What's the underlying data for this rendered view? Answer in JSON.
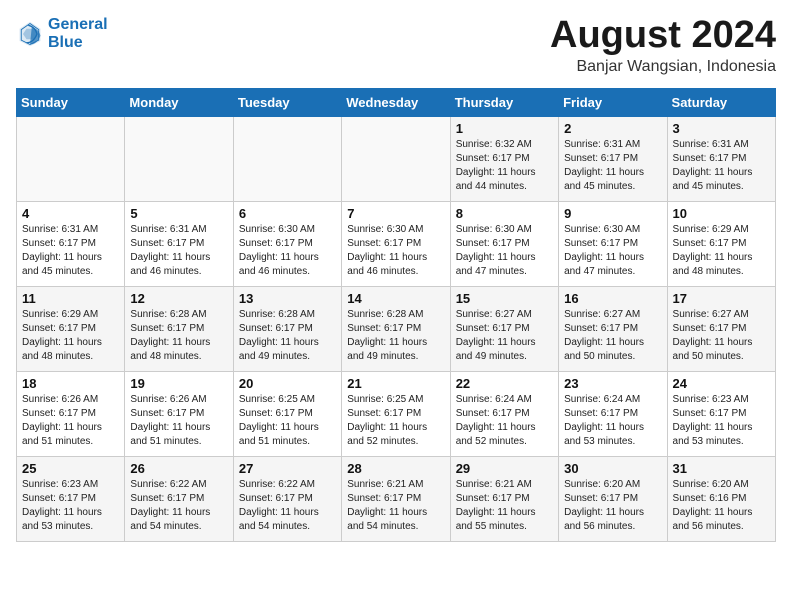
{
  "header": {
    "logo_line1": "General",
    "logo_line2": "Blue",
    "month_title": "August 2024",
    "subtitle": "Banjar Wangsian, Indonesia"
  },
  "days_of_week": [
    "Sunday",
    "Monday",
    "Tuesday",
    "Wednesday",
    "Thursday",
    "Friday",
    "Saturday"
  ],
  "weeks": [
    [
      {
        "day": "",
        "info": ""
      },
      {
        "day": "",
        "info": ""
      },
      {
        "day": "",
        "info": ""
      },
      {
        "day": "",
        "info": ""
      },
      {
        "day": "1",
        "info": "Sunrise: 6:32 AM\nSunset: 6:17 PM\nDaylight: 11 hours\nand 44 minutes."
      },
      {
        "day": "2",
        "info": "Sunrise: 6:31 AM\nSunset: 6:17 PM\nDaylight: 11 hours\nand 45 minutes."
      },
      {
        "day": "3",
        "info": "Sunrise: 6:31 AM\nSunset: 6:17 PM\nDaylight: 11 hours\nand 45 minutes."
      }
    ],
    [
      {
        "day": "4",
        "info": "Sunrise: 6:31 AM\nSunset: 6:17 PM\nDaylight: 11 hours\nand 45 minutes."
      },
      {
        "day": "5",
        "info": "Sunrise: 6:31 AM\nSunset: 6:17 PM\nDaylight: 11 hours\nand 46 minutes."
      },
      {
        "day": "6",
        "info": "Sunrise: 6:30 AM\nSunset: 6:17 PM\nDaylight: 11 hours\nand 46 minutes."
      },
      {
        "day": "7",
        "info": "Sunrise: 6:30 AM\nSunset: 6:17 PM\nDaylight: 11 hours\nand 46 minutes."
      },
      {
        "day": "8",
        "info": "Sunrise: 6:30 AM\nSunset: 6:17 PM\nDaylight: 11 hours\nand 47 minutes."
      },
      {
        "day": "9",
        "info": "Sunrise: 6:30 AM\nSunset: 6:17 PM\nDaylight: 11 hours\nand 47 minutes."
      },
      {
        "day": "10",
        "info": "Sunrise: 6:29 AM\nSunset: 6:17 PM\nDaylight: 11 hours\nand 48 minutes."
      }
    ],
    [
      {
        "day": "11",
        "info": "Sunrise: 6:29 AM\nSunset: 6:17 PM\nDaylight: 11 hours\nand 48 minutes."
      },
      {
        "day": "12",
        "info": "Sunrise: 6:28 AM\nSunset: 6:17 PM\nDaylight: 11 hours\nand 48 minutes."
      },
      {
        "day": "13",
        "info": "Sunrise: 6:28 AM\nSunset: 6:17 PM\nDaylight: 11 hours\nand 49 minutes."
      },
      {
        "day": "14",
        "info": "Sunrise: 6:28 AM\nSunset: 6:17 PM\nDaylight: 11 hours\nand 49 minutes."
      },
      {
        "day": "15",
        "info": "Sunrise: 6:27 AM\nSunset: 6:17 PM\nDaylight: 11 hours\nand 49 minutes."
      },
      {
        "day": "16",
        "info": "Sunrise: 6:27 AM\nSunset: 6:17 PM\nDaylight: 11 hours\nand 50 minutes."
      },
      {
        "day": "17",
        "info": "Sunrise: 6:27 AM\nSunset: 6:17 PM\nDaylight: 11 hours\nand 50 minutes."
      }
    ],
    [
      {
        "day": "18",
        "info": "Sunrise: 6:26 AM\nSunset: 6:17 PM\nDaylight: 11 hours\nand 51 minutes."
      },
      {
        "day": "19",
        "info": "Sunrise: 6:26 AM\nSunset: 6:17 PM\nDaylight: 11 hours\nand 51 minutes."
      },
      {
        "day": "20",
        "info": "Sunrise: 6:25 AM\nSunset: 6:17 PM\nDaylight: 11 hours\nand 51 minutes."
      },
      {
        "day": "21",
        "info": "Sunrise: 6:25 AM\nSunset: 6:17 PM\nDaylight: 11 hours\nand 52 minutes."
      },
      {
        "day": "22",
        "info": "Sunrise: 6:24 AM\nSunset: 6:17 PM\nDaylight: 11 hours\nand 52 minutes."
      },
      {
        "day": "23",
        "info": "Sunrise: 6:24 AM\nSunset: 6:17 PM\nDaylight: 11 hours\nand 53 minutes."
      },
      {
        "day": "24",
        "info": "Sunrise: 6:23 AM\nSunset: 6:17 PM\nDaylight: 11 hours\nand 53 minutes."
      }
    ],
    [
      {
        "day": "25",
        "info": "Sunrise: 6:23 AM\nSunset: 6:17 PM\nDaylight: 11 hours\nand 53 minutes."
      },
      {
        "day": "26",
        "info": "Sunrise: 6:22 AM\nSunset: 6:17 PM\nDaylight: 11 hours\nand 54 minutes."
      },
      {
        "day": "27",
        "info": "Sunrise: 6:22 AM\nSunset: 6:17 PM\nDaylight: 11 hours\nand 54 minutes."
      },
      {
        "day": "28",
        "info": "Sunrise: 6:21 AM\nSunset: 6:17 PM\nDaylight: 11 hours\nand 54 minutes."
      },
      {
        "day": "29",
        "info": "Sunrise: 6:21 AM\nSunset: 6:17 PM\nDaylight: 11 hours\nand 55 minutes."
      },
      {
        "day": "30",
        "info": "Sunrise: 6:20 AM\nSunset: 6:17 PM\nDaylight: 11 hours\nand 56 minutes."
      },
      {
        "day": "31",
        "info": "Sunrise: 6:20 AM\nSunset: 6:16 PM\nDaylight: 11 hours\nand 56 minutes."
      }
    ]
  ]
}
